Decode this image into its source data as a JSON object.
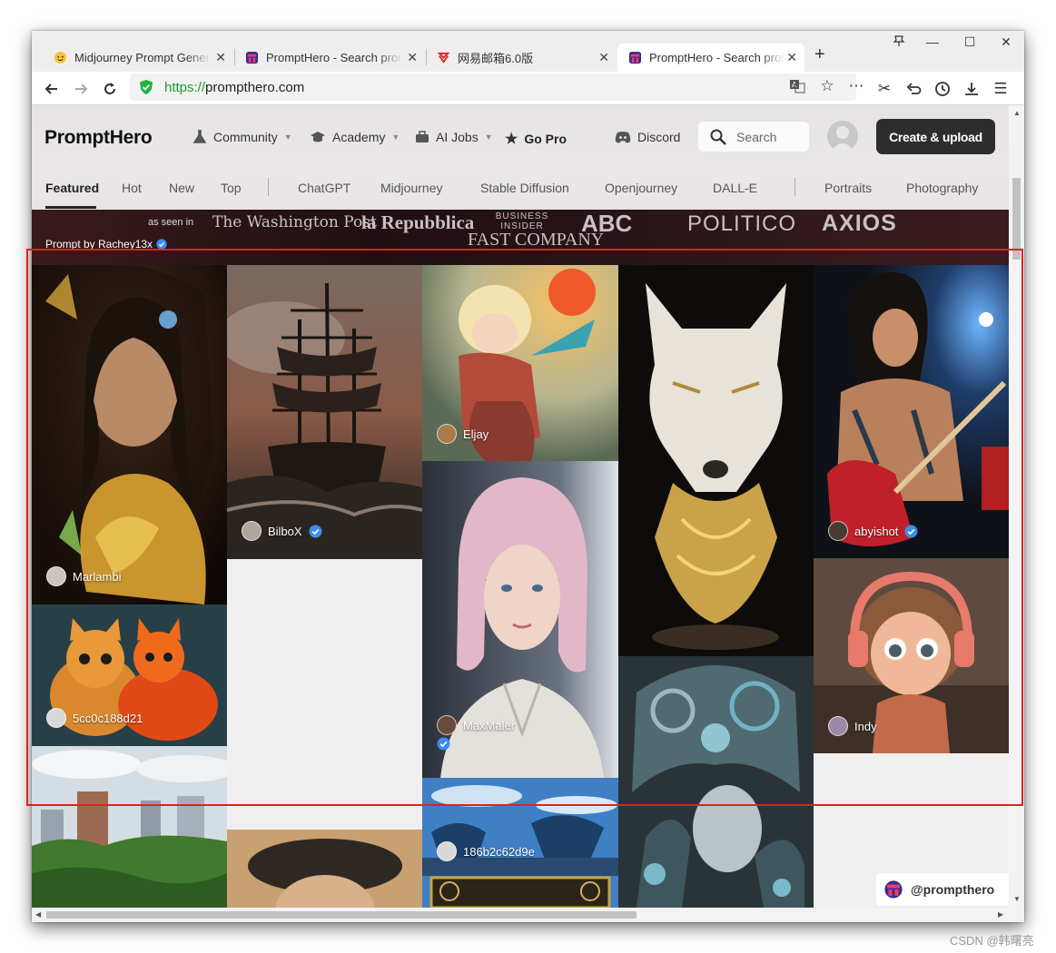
{
  "browser": {
    "tabs": [
      {
        "title": "Midjourney Prompt Generator",
        "icon": "emoji-icon",
        "active": false
      },
      {
        "title": "PromptHero - Search prompts",
        "icon": "prompthero-icon",
        "active": false
      },
      {
        "title": "网易邮箱6.0版",
        "icon": "netease-icon",
        "active": false
      },
      {
        "title": "PromptHero - Search prompts",
        "icon": "prompthero-icon",
        "active": true
      }
    ],
    "new_tab": "+",
    "url_scheme": "https://",
    "url_host": "prompthero.com"
  },
  "header": {
    "logo": "PromptHero",
    "nav": [
      {
        "label": "Community",
        "icon": "flask-icon",
        "dropdown": true
      },
      {
        "label": "Academy",
        "icon": "graduation-cap-icon",
        "dropdown": true
      },
      {
        "label": "AI Jobs",
        "icon": "briefcase-icon",
        "dropdown": true
      },
      {
        "label": "Go Pro",
        "icon": "star-icon",
        "dropdown": false
      },
      {
        "label": "Discord",
        "icon": "discord-icon",
        "dropdown": false
      }
    ],
    "search_placeholder": "Search",
    "create_button": "Create & upload"
  },
  "categories": {
    "sorts": [
      "Featured",
      "Hot",
      "New",
      "Top"
    ],
    "models": [
      "ChatGPT",
      "Midjourney",
      "Stable Diffusion",
      "Openjourney",
      "DALL-E"
    ],
    "topics": [
      "Portraits",
      "Photography"
    ],
    "active": "Featured"
  },
  "press": {
    "as_seen_in": "as seen in",
    "logos": [
      "The Washington Post",
      "la Repubblica",
      "BUSINESS INSIDER",
      "FAST COMPANY",
      "ABC",
      "POLITICO",
      "AXIOS"
    ],
    "credit": "Prompt by Rachey13x"
  },
  "gallery": [
    {
      "user": "Marlambi",
      "verified": false
    },
    {
      "user": "5cc0c188d21",
      "verified": false
    },
    {
      "user": "BilboX",
      "verified": true
    },
    {
      "user": "Eljay",
      "verified": false
    },
    {
      "user": "MaxMaler",
      "verified": true
    },
    {
      "user": "186b2c62d9e",
      "verified": false
    },
    {
      "user": "abyishot",
      "verified": true
    },
    {
      "user": "Indy",
      "verified": false
    }
  ],
  "watermark": "@prompthero",
  "footer_credit": "CSDN @韩曙亮",
  "colors": {
    "accent_dark": "#2d2d2d",
    "url_scheme_green": "#1c9b2e",
    "verified_blue": "#3a8df0",
    "highlight_red": "#e02020"
  }
}
